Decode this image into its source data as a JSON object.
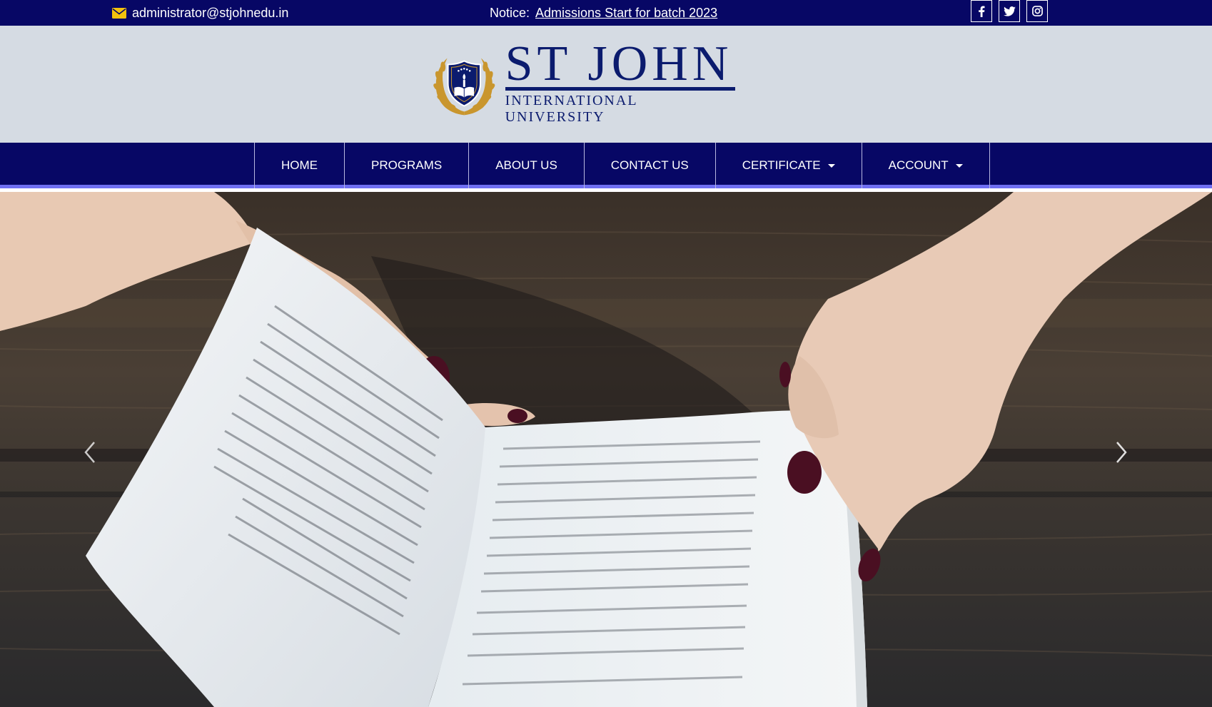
{
  "topbar": {
    "email": "administrator@stjohnedu.in",
    "notice_label": "Notice:",
    "notice_link": "Admissions Start for batch 2023",
    "socials": [
      {
        "icon": "facebook-icon"
      },
      {
        "icon": "twitter-icon"
      },
      {
        "icon": "instagram-icon"
      }
    ]
  },
  "logo": {
    "name": "ST JOHN",
    "subtitle": "INTERNATIONAL UNIVERSITY"
  },
  "nav": {
    "items": [
      {
        "label": "HOME"
      },
      {
        "label": "PROGRAMS"
      },
      {
        "label": "ABOUT US"
      },
      {
        "label": "CONTACT US"
      },
      {
        "label": "CERTIFICATE",
        "dropdown": true
      },
      {
        "label": "ACCOUNT",
        "dropdown": true
      }
    ]
  },
  "hero": {
    "prev_icon": "chevron-left-icon",
    "next_icon": "chevron-right-icon"
  },
  "colors": {
    "topbar": "#070765",
    "header_bg": "#d5dbe3",
    "brand": "#0b1b6e",
    "nav_accent": "#6f6ff2",
    "crest_gold": "#c9962e"
  }
}
